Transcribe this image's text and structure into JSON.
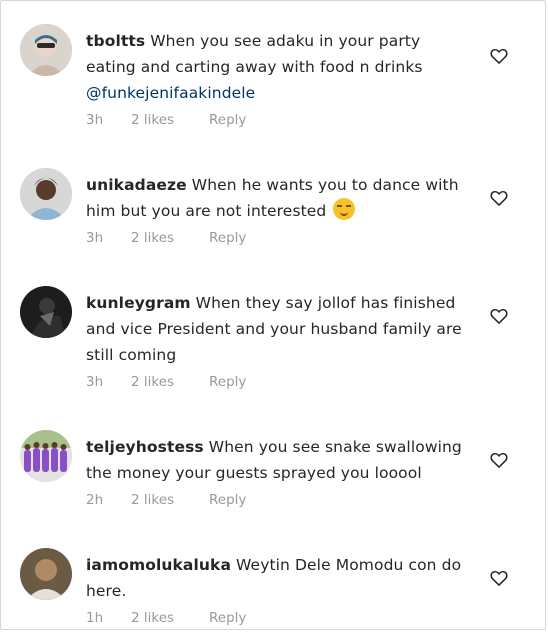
{
  "comments": [
    {
      "username": "tboltts",
      "text": " When you see adaku in your party eating and carting away with food n drinks ",
      "mention": "@funkejenifaakindele",
      "time": "3h",
      "likes": "2 likes",
      "reply": "Reply",
      "avatar_colors": [
        "#d9d4cc",
        "#e8d6c8",
        "#3c6e8c"
      ]
    },
    {
      "username": "unikadaeze",
      "text": " When he wants you to dance with him but you are not interested ",
      "emoji": "smiling-face-emoji",
      "time": "3h",
      "likes": "2 likes",
      "reply": "Reply",
      "avatar_colors": [
        "#2a2a2a",
        "#8fb4d4",
        "#d7d7d7"
      ]
    },
    {
      "username": "kunleygram",
      "text": " When they say jollof has finished and vice President and your husband family are still coming",
      "time": "3h",
      "likes": "2 likes",
      "reply": "Reply",
      "avatar_colors": [
        "#1d1d1d",
        "#3a3a3a",
        "#6b6b6b"
      ]
    },
    {
      "username": "teljeyhostess",
      "text": " When you see snake swallowing the money your guests sprayed you looool",
      "time": "2h",
      "likes": "2 likes",
      "reply": "Reply",
      "avatar_colors": [
        "#e3e3e3",
        "#8a4fc4",
        "#a7c08c"
      ]
    },
    {
      "username": "iamomolukaluka",
      "text": " Weytin Dele Momodu con do here.",
      "time": "1h",
      "likes": "2 likes",
      "reply": "Reply",
      "avatar_colors": [
        "#6b5a44",
        "#b08a63",
        "#3d3226"
      ]
    }
  ],
  "icons": {
    "like": "heart-outline-icon"
  }
}
